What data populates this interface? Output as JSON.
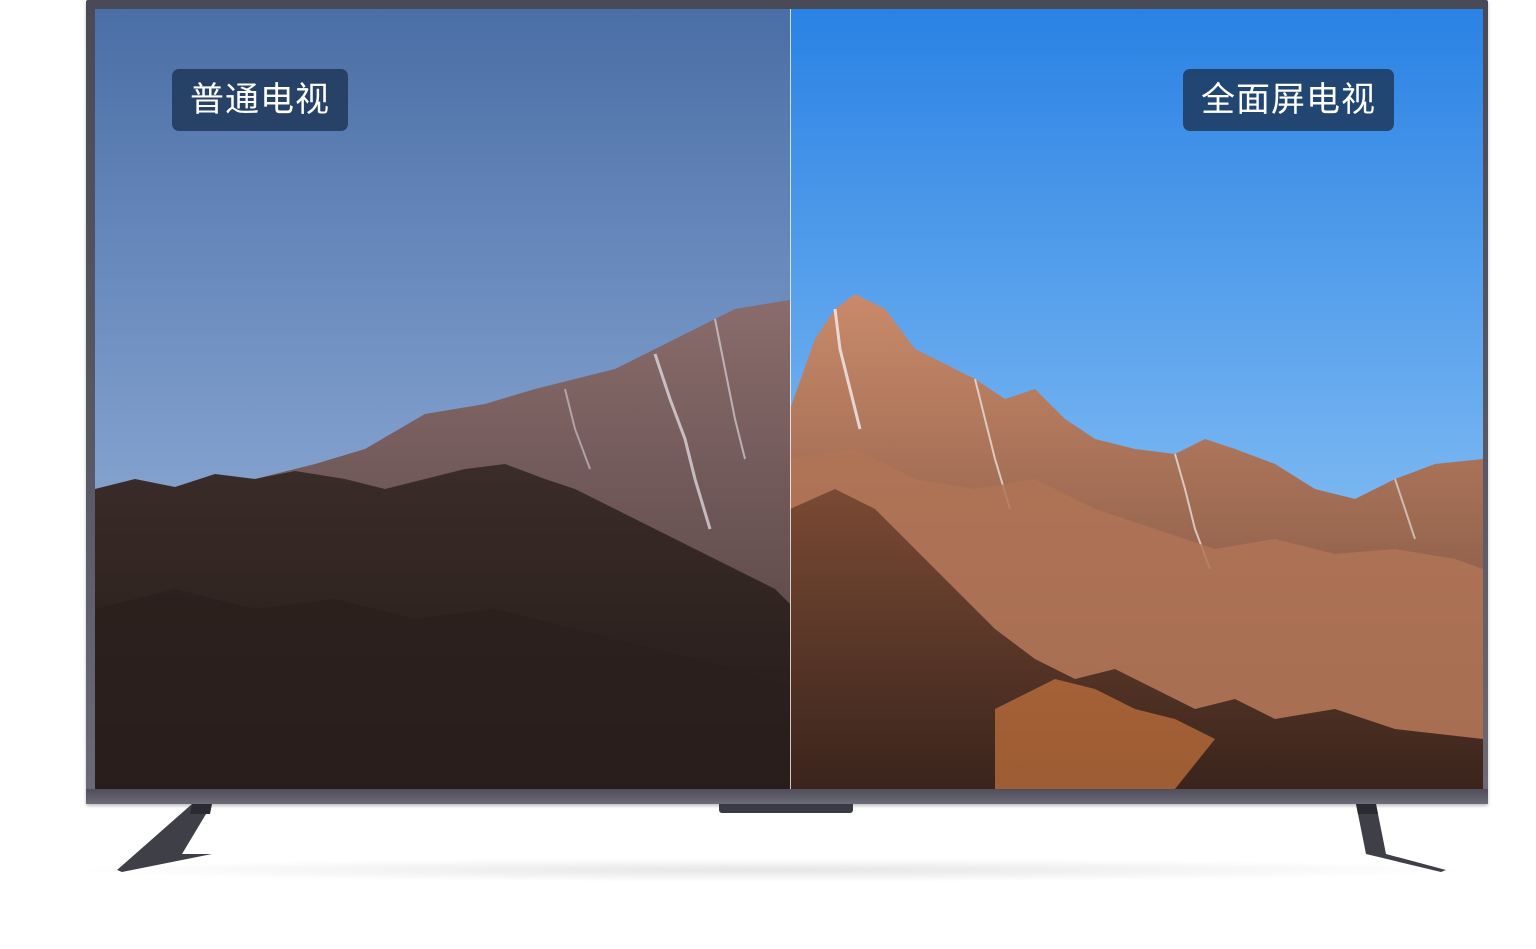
{
  "comparison": {
    "left_label": "普通电视",
    "right_label": "全面屏电视"
  },
  "colors": {
    "frame": "#5a5966",
    "badge_bg": "#1c3454",
    "sky_left_top": "#4a6fa8",
    "sky_right_top": "#2f86e6"
  }
}
